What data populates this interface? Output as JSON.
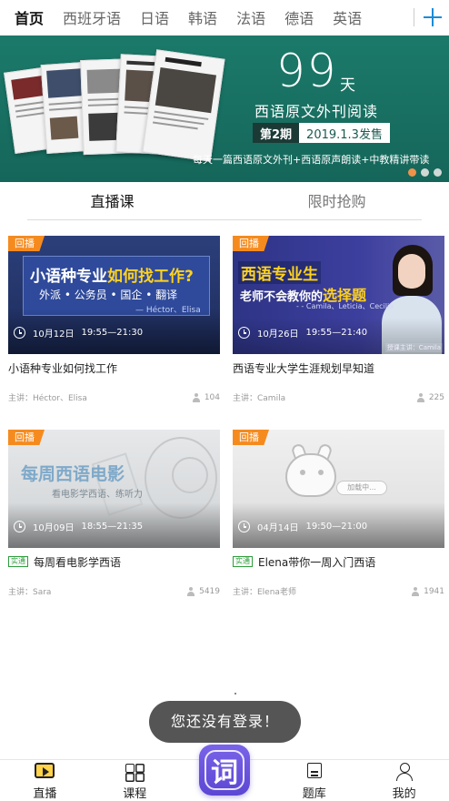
{
  "top_tabs": [
    "首页",
    "西班牙语",
    "日语",
    "韩语",
    "法语",
    "德语",
    "英语"
  ],
  "top_tab_active": 0,
  "banner": {
    "big_number": "99",
    "big_unit": "天",
    "title": "西语原文外刊阅读",
    "issue": "第2期",
    "date": "2019.1.3发售",
    "subtitle": "每天一篇西语原文外刊+西语原声朗读+中教精讲带读",
    "dots_count": 3,
    "active_dot": 0,
    "dot_colors": {
      "active": "#f0924a",
      "inactive": "#cfd8d6"
    }
  },
  "section_tabs": [
    "直播课",
    "限时抢购"
  ],
  "courses": [
    {
      "badge": "回播",
      "thumb": {
        "headline_main": "小语种专业",
        "headline_highlight": "如何找工作?",
        "tags": "外派 • 公务员 • 国企 • 翻译",
        "names": "— Héctor、Elisa"
      },
      "time": "10月12日",
      "time_range": "19:55—21:30",
      "title": "小语种专业如何找工作",
      "replay_tag": "",
      "lecturer": "主讲：Héctor、Elisa",
      "viewers": "104"
    },
    {
      "badge": "回播",
      "thumb": {
        "headline_main": "西语专业生",
        "line2_plain": "老师不会教你的",
        "line2_highlight": "选择题",
        "names": "- - Camila、Leticia、Cecilia",
        "caption": "授课主讲：Camila"
      },
      "time": "10月26日",
      "time_range": "19:55—21:40",
      "title": "西语专业大学生涯规划早知道",
      "replay_tag": "",
      "lecturer": "主讲：Camila",
      "viewers": "225"
    },
    {
      "badge": "回播",
      "thumb": {
        "headline_main": "每周西语电影",
        "subline": "看电影学西语、练听力"
      },
      "time": "10月09日",
      "time_range": "18:55—21:35",
      "title": "每周看电影学西语",
      "replay_tag": "实通",
      "lecturer": "主讲：Sara",
      "viewers": "5419"
    },
    {
      "badge": "回播",
      "thumb": {
        "bubble": "加载中..."
      },
      "time": "04月14日",
      "time_range": "19:50—21:00",
      "title": "Elena带你一周入门西语",
      "replay_tag": "实通",
      "lecturer": "主讲：Elena老师",
      "viewers": "1941"
    }
  ],
  "toast": "您还没有登录！",
  "bottom_nav": {
    "items": [
      "直播",
      "课程",
      "题库",
      "我的"
    ],
    "center_glyph": "词",
    "active": 0
  },
  "colors": {
    "banner_bg": "#1b7a6a",
    "badge": "#f58b1f",
    "accent_blue": "#1a8cd8",
    "center_button": "#6a55de",
    "replay_tag": "#2e9b3c"
  }
}
